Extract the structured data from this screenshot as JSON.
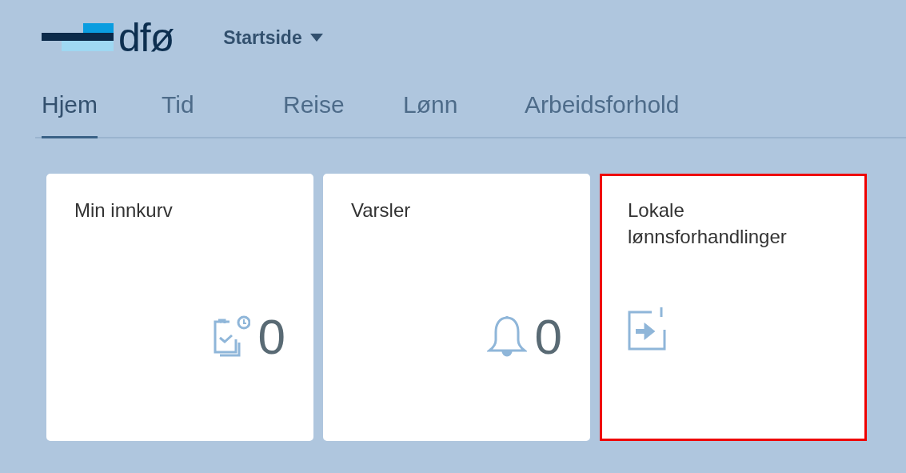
{
  "header": {
    "logo_text": "dfø",
    "page_menu": {
      "label": "Startside",
      "expanded": false
    }
  },
  "tabs": [
    {
      "label": "Hjem",
      "selected": true
    },
    {
      "label": "Tid",
      "selected": false
    },
    {
      "label": "Reise",
      "selected": false
    },
    {
      "label": "Lønn",
      "selected": false
    },
    {
      "label": "Arbeidsforhold",
      "selected": false
    }
  ],
  "tiles": [
    {
      "kind": "inbox",
      "title": "Min innkurv",
      "count": "0",
      "highlighted": false
    },
    {
      "kind": "notifications",
      "title": "Varsler",
      "count": "0",
      "highlighted": false
    },
    {
      "kind": "launch",
      "title": "Lokale lønnsforhandlinger",
      "highlighted": true
    }
  ]
}
